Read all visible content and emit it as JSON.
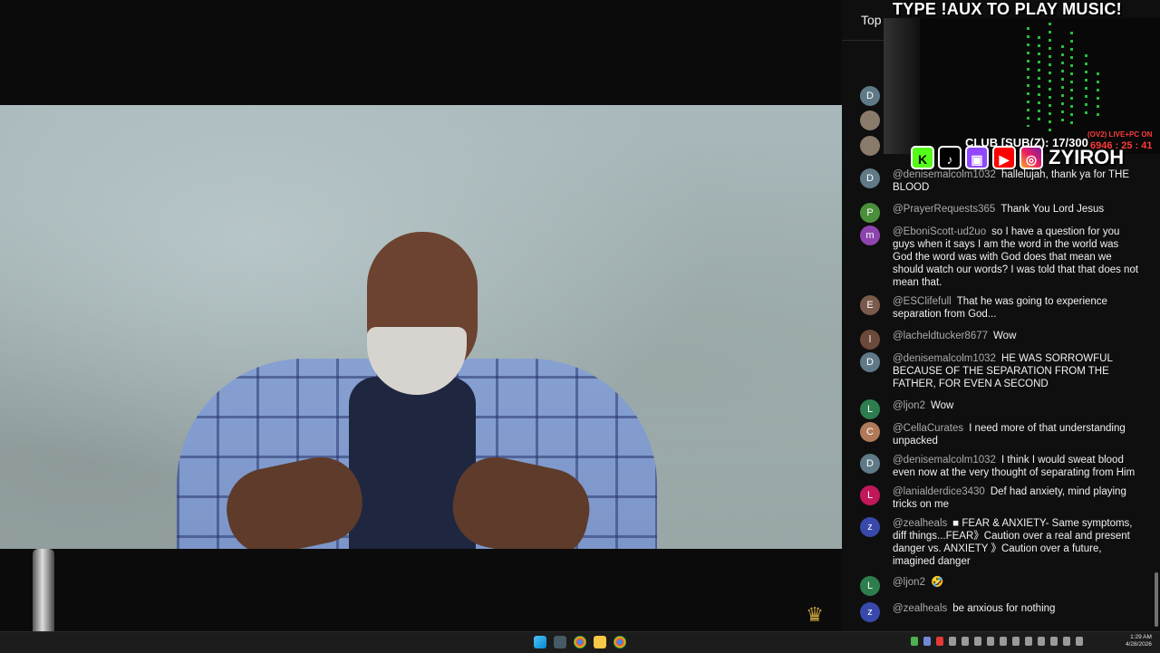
{
  "overlay": {
    "title": "TYPE !AUX TO PLAY MUSIC!",
    "live_tag": "(OV2) LIVE+PC ON",
    "timer": "6946 : 25 : 41",
    "sub_goal": "CLUB [SUB(Z): 17/300",
    "handle": "ZYIROH",
    "social_icons": [
      "kick-icon",
      "tiktok-icon",
      "twitch-icon",
      "youtube-icon",
      "instagram-icon"
    ]
  },
  "chat": {
    "mode_label": "Top",
    "messages": [
      {
        "avatar": "D",
        "avatar_color": "#5f7a86",
        "author": "@denisemalcolm1032",
        "text": "hallelujah, thank ya for THE BLOOD"
      },
      {
        "avatar": "P",
        "avatar_color": "#4a8f3a",
        "author": "@PrayerRequests365",
        "text": "Thank You Lord Jesus"
      },
      {
        "avatar": "m",
        "avatar_color": "#8e44ad",
        "author": "@EboniScott-ud2uo",
        "text": "so I have a question for you guys when it says I am the word in the world was God the word was with God does that mean we should watch our words? I was told that that does not mean that."
      },
      {
        "avatar": "E",
        "avatar_color": "#7a5a4a",
        "author": "@ESClifefull",
        "text": "That he was going to experience separation from God..."
      },
      {
        "avatar": "l",
        "avatar_color": "#6b4a3a",
        "author": "@lacheldtucker8677",
        "text": "Wow"
      },
      {
        "avatar": "D",
        "avatar_color": "#5f7a86",
        "author": "@denisemalcolm1032",
        "text": "HE WAS SORROWFUL BECAUSE OF THE SEPARATION FROM THE FATHER, FOR EVEN A SECOND"
      },
      {
        "avatar": "L",
        "avatar_color": "#2e7d4f",
        "author": "@ljon2",
        "text": "Wow"
      },
      {
        "avatar": "C",
        "avatar_color": "#b07a5a",
        "author": "@CellaCurates",
        "text": "I need more of that understanding unpacked"
      },
      {
        "avatar": "D",
        "avatar_color": "#5f7a86",
        "author": "@denisemalcolm1032",
        "text": "I think I would sweat blood even now at the very thought of separating from Him"
      },
      {
        "avatar": "L",
        "avatar_color": "#c2185b",
        "author": "@lanialderdice3430",
        "text": "Def had anxiety, mind playing tricks on me"
      },
      {
        "avatar": "z",
        "avatar_color": "#3949ab",
        "author": "@zealheals",
        "text": "■ FEAR & ANXIETY- Same symptoms, diff things...FEAR》Caution over a real and present danger vs. ANXIETY 》Caution over a future, imagined danger"
      },
      {
        "avatar": "L",
        "avatar_color": "#2e7d4f",
        "author": "@ljon2",
        "text": "🤣"
      },
      {
        "avatar": "z",
        "avatar_color": "#3949ab",
        "author": "@zealheals",
        "text": "be anxious for nothing"
      }
    ]
  },
  "taskbar": {
    "time": "1:29 AM",
    "date": "4/28/2026"
  }
}
